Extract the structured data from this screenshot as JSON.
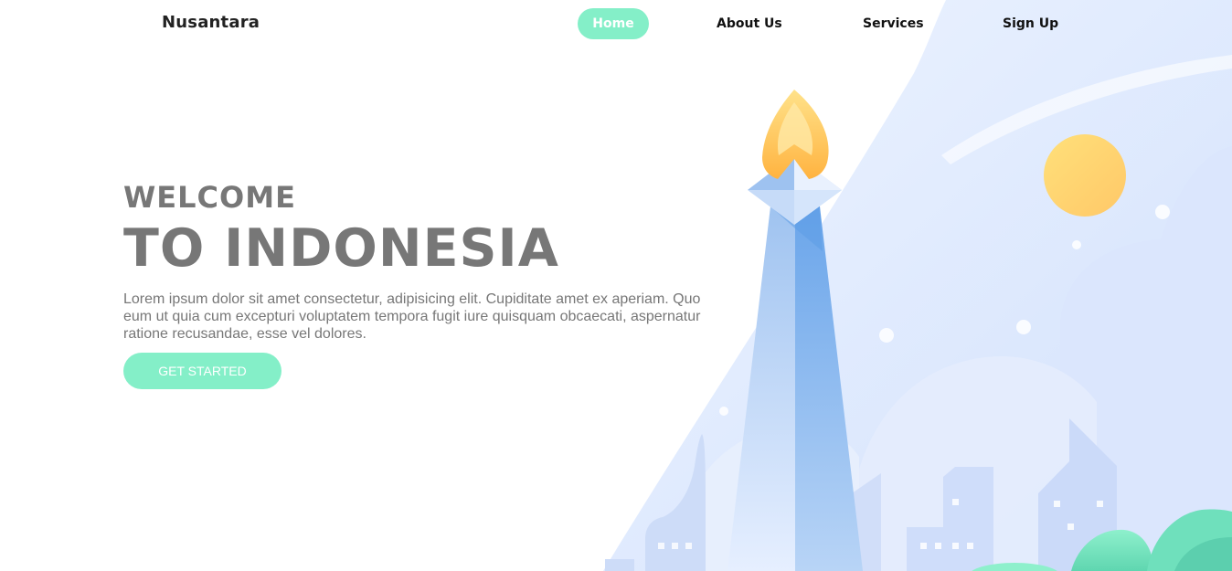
{
  "header": {
    "brand": "Nusantara",
    "nav": [
      {
        "label": "Home",
        "active": true
      },
      {
        "label": "About Us",
        "active": false
      },
      {
        "label": "Services",
        "active": false
      },
      {
        "label": "Sign Up",
        "active": false
      }
    ]
  },
  "hero": {
    "welcome": "WELCOME",
    "headline": "TO INDONESIA",
    "lead": "Lorem ipsum dolor sit amet consectetur, adipisicing elit. Cupiditate amet ex aperiam. Quo eum ut quia cum excepturi voluptatem tempora fugit iure quisquam obcaecati, aspernatur ratione recusandae, esse vel dolores.",
    "cta_label": "GET STARTED"
  },
  "colors": {
    "accent": "#84efc8",
    "text": "#777777",
    "sky": "#dbe7fd",
    "monument": "#8ab8ee",
    "flame": "#ffc24a",
    "sun": "#ffd36a"
  },
  "illustration": {
    "icon_name": "monas-monument-illustration"
  }
}
